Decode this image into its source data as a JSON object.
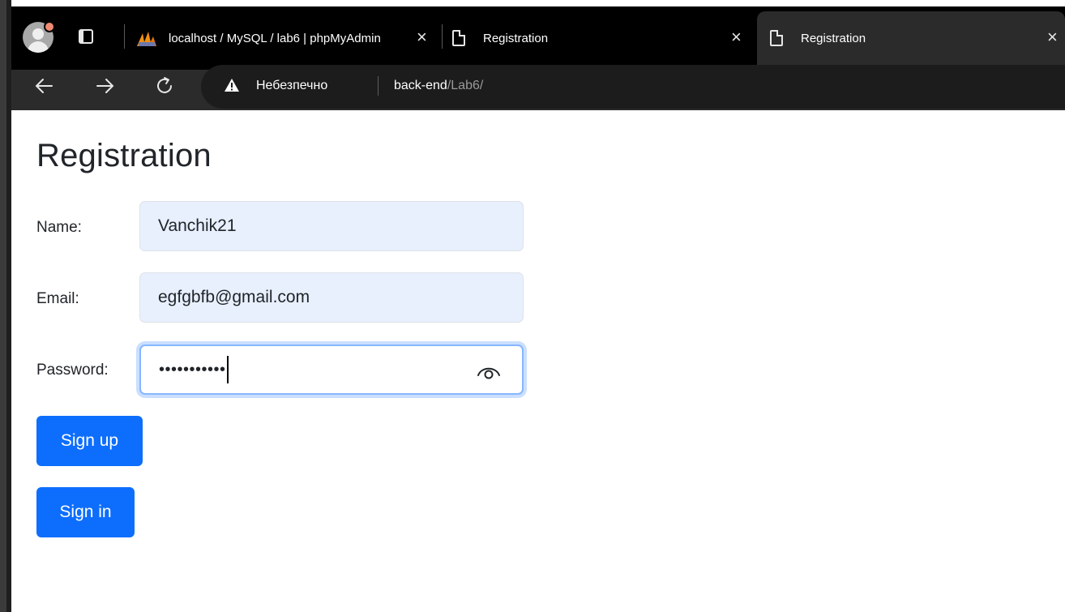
{
  "browser": {
    "tabs": [
      {
        "label": "localhost / MySQL / lab6 | phpMyAdmin",
        "active": false
      },
      {
        "label": "Registration",
        "active": false
      },
      {
        "label": "Registration",
        "active": true
      }
    ],
    "address_bar": {
      "security_label": "Небезпечно",
      "url_host": "back-end",
      "url_path": "/Lab6/"
    }
  },
  "page": {
    "title": "Registration",
    "form": {
      "name_label": "Name:",
      "name_value": "Vanchik21",
      "email_label": "Email:",
      "email_value": "egfgbfb@gmail.com",
      "password_label": "Password:",
      "password_masked": "•••••••••••",
      "signup_label": "Sign up",
      "signin_label": "Sign in"
    }
  },
  "icons": {
    "back": "back-arrow-icon",
    "forward": "forward-arrow-icon",
    "reload": "reload-icon",
    "warning": "warning-triangle-icon",
    "password_reveal": "eye-icon"
  },
  "colors": {
    "primary": "#0d6efd",
    "autofill_bg": "#e8f0fe",
    "focus_ring": "#86b7fe",
    "tabbar_bg": "#000000",
    "toolbar_bg": "#2b2b2b"
  }
}
